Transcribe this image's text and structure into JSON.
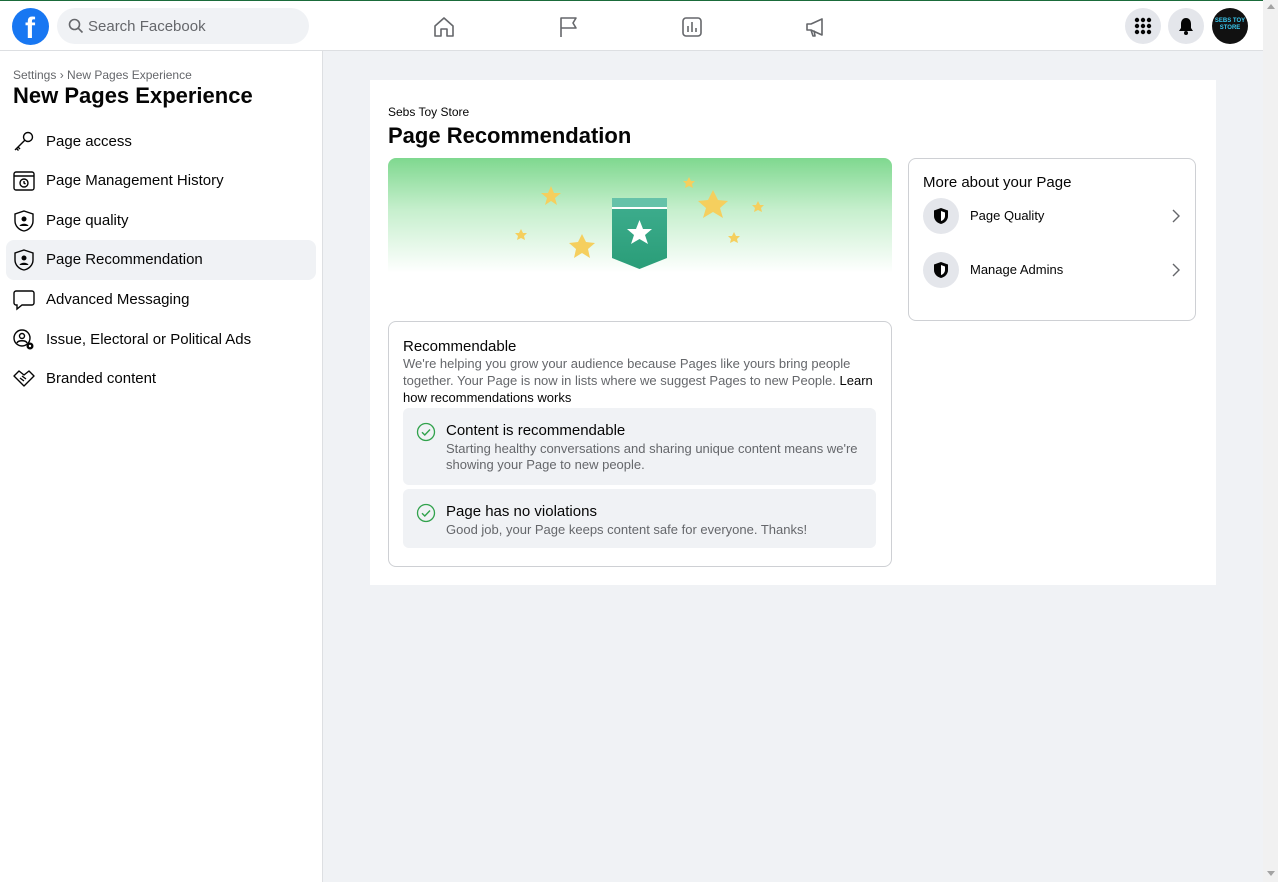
{
  "topbar": {
    "logo_letter": "f",
    "search_placeholder": "Search Facebook",
    "nav_icons": [
      "home-icon",
      "flag-icon",
      "insights-icon",
      "megaphone-icon"
    ],
    "right_icons": [
      "menu-grid-icon",
      "bell-icon"
    ],
    "avatar_text": "SEBS TOY STORE",
    "brand_color": "#1877f2"
  },
  "sidebar": {
    "breadcrumb": "Settings › New Pages Experience",
    "title": "New Pages Experience",
    "items": [
      {
        "label": "Page access",
        "icon": "key-icon"
      },
      {
        "label": "Page Management History",
        "icon": "history-icon"
      },
      {
        "label": "Page quality",
        "icon": "shield-person-icon"
      },
      {
        "label": "Page Recommendation",
        "icon": "shield-person-icon",
        "active": true
      },
      {
        "label": "Advanced Messaging",
        "icon": "speech-bubble-icon"
      },
      {
        "label": "Issue, Electoral or Political Ads",
        "icon": "person-gear-icon"
      },
      {
        "label": "Branded content",
        "icon": "handshake-icon"
      }
    ]
  },
  "main": {
    "page_name": "Sebs Toy Store",
    "heading": "Page Recommendation",
    "recommendable": {
      "title": "Recommendable",
      "description": "We're helping you grow your audience because Pages like yours bring people together. Your Page is now in lists where we suggest Pages to new People.",
      "link": "Learn how recommendations works",
      "checks": [
        {
          "title": "Content is recommendable",
          "description": "Starting healthy conversations and sharing unique content means we're showing your Page to new people."
        },
        {
          "title": "Page has no violations",
          "description": "Good job, your Page keeps content safe for everyone. Thanks!"
        }
      ]
    },
    "more": {
      "title": "More about your Page",
      "items": [
        {
          "label": "Page Quality",
          "icon": "shield-icon"
        },
        {
          "label": "Manage Admins",
          "icon": "shield-icon"
        }
      ]
    }
  }
}
